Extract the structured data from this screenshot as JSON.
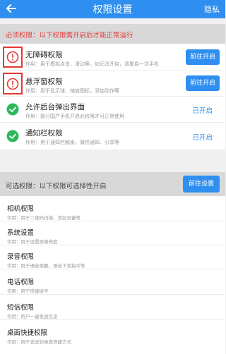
{
  "header": {
    "title": "权限设置",
    "right_label": "隐私"
  },
  "required_banner": {
    "text": "必须权限：以下权限需开启后才能正常运行"
  },
  "required_items": [
    {
      "name": "无障碍权限",
      "desc": "作用：用于模拟点击、滑动等，如无法开启，请重启一次手机",
      "action": "前往开启",
      "status": "warning"
    },
    {
      "name": "悬浮窗权限",
      "desc": "作用：用于显示球、缩放图标，添加动作等",
      "action": "前往开启",
      "status": "warning"
    },
    {
      "name": "允许后台弹出界面",
      "desc": "作用：部分国产手机开启此权限才可正常使用",
      "action": "已开启",
      "status": "ok"
    },
    {
      "name": "通知栏权限",
      "desc": "作用：用于通知栏触发、微信通知、分享等",
      "action": "已开启",
      "status": "ok"
    }
  ],
  "optional_banner": {
    "text": "可选权限：以下权限可选择性开启",
    "button": "前往设置"
  },
  "optional_items": [
    {
      "name": "相机权限",
      "desc": "作用：用于二维码扫描、添加设备等"
    },
    {
      "name": "系统设置",
      "desc": "作用：用于设置屏幕亮度"
    },
    {
      "name": "录音权限",
      "desc": "作用：用于语音唤醒、语音下发指令等"
    },
    {
      "name": "电话权限",
      "desc": "作用：用于快捷拨号"
    },
    {
      "name": "短信权限",
      "desc": "作用：用户一键发送信息"
    },
    {
      "name": "桌面快捷权限",
      "desc": "作用：用于发送到桌面快捷方式"
    }
  ],
  "colors": {
    "primary": "#2f8ff0",
    "warning": "#e53935",
    "ok": "#2eb85c"
  }
}
